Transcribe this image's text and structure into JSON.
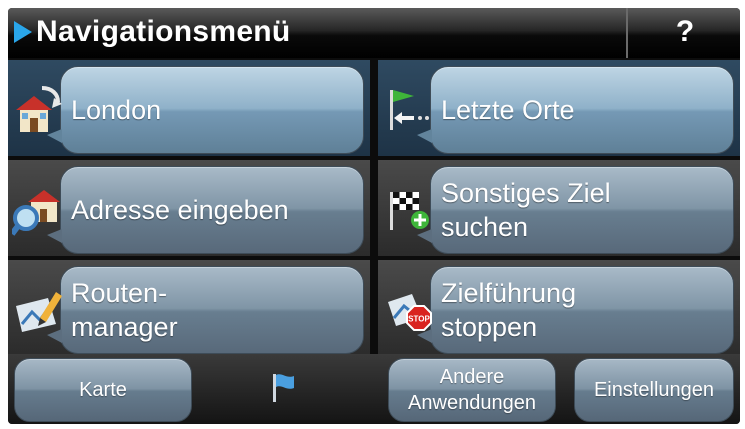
{
  "title_bar": {
    "title": "Navigationsmenü",
    "help_label": "?"
  },
  "menu": {
    "london": {
      "label": "London",
      "icon": "home-icon"
    },
    "last_places": {
      "label": "Letzte Orte",
      "icon": "flag-arrow-icon"
    },
    "address": {
      "label": "Adresse eingeben",
      "icon": "house-search-icon"
    },
    "other_destination": {
      "label_line1": "Sonstiges Ziel",
      "label_line2": "suchen",
      "icon": "checkered-flag-add-icon"
    },
    "route_manager": {
      "label_line1": "Routen-",
      "label_line2": "manager",
      "icon": "route-map-pencil-icon"
    },
    "stop_guidance": {
      "label_line1": "Zielführung",
      "label_line2": "stoppen",
      "icon": "stop-sign-icon"
    }
  },
  "bottom_bar": {
    "map_label": "Karte",
    "flag_icon": "flag-icon",
    "other_apps_line1": "Andere",
    "other_apps_line2": "Anwendungen",
    "settings_label": "Einstellungen"
  },
  "colors": {
    "accent": "#2aa6ea",
    "selected_tile": "#2f4a61",
    "button": "#7e93a4"
  }
}
